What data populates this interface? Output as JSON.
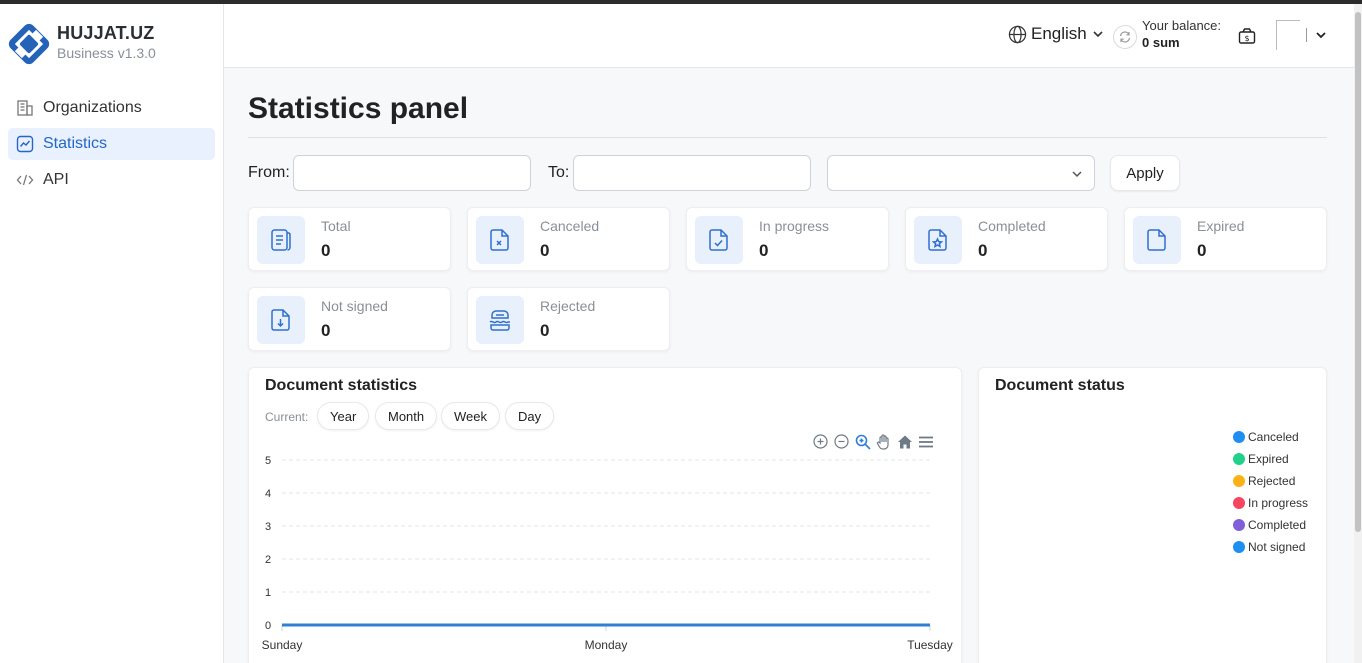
{
  "app": {
    "name": "HUJJAT.UZ",
    "version": "Business v1.3.0"
  },
  "sidebar": {
    "items": [
      {
        "label": "Organizations",
        "icon": "building-icon",
        "active": false
      },
      {
        "label": "Statistics",
        "icon": "chart-icon",
        "active": true
      },
      {
        "label": "API",
        "icon": "code-icon",
        "active": false
      }
    ]
  },
  "header": {
    "language": "English",
    "balance_label": "Your balance:",
    "balance_value": "0 sum"
  },
  "page": {
    "title": "Statistics panel"
  },
  "filters": {
    "from_label": "From:",
    "to_label": "To:",
    "from_value": "",
    "to_value": "",
    "select_value": "",
    "apply_label": "Apply"
  },
  "cards": [
    {
      "label": "Total",
      "value": "0",
      "icon": "document-list-icon"
    },
    {
      "label": "Canceled",
      "value": "0",
      "icon": "document-cancel-icon"
    },
    {
      "label": "In progress",
      "value": "0",
      "icon": "document-check-icon"
    },
    {
      "label": "Completed",
      "value": "0",
      "icon": "document-star-icon"
    },
    {
      "label": "Expired",
      "value": "0",
      "icon": "document-icon"
    },
    {
      "label": "Not signed",
      "value": "0",
      "icon": "document-download-icon"
    },
    {
      "label": "Rejected",
      "value": "0",
      "icon": "document-reject-icon"
    }
  ],
  "doc_stats": {
    "title": "Document statistics",
    "current_label": "Current:",
    "periods": [
      "Year",
      "Month",
      "Week",
      "Day"
    ]
  },
  "doc_status": {
    "title": "Document status",
    "legend": [
      {
        "label": "Canceled",
        "color": "#1e8ef0"
      },
      {
        "label": "Expired",
        "color": "#1fd18b"
      },
      {
        "label": "Rejected",
        "color": "#fbb117"
      },
      {
        "label": "In progress",
        "color": "#f6455f"
      },
      {
        "label": "Completed",
        "color": "#8060d8"
      },
      {
        "label": "Not signed",
        "color": "#1e8ef0"
      }
    ]
  },
  "colors": {
    "accent": "#2566c9",
    "line": "#2f7fd8",
    "icon_bg": "#e8f0fb"
  },
  "chart_data": {
    "type": "line",
    "categories": [
      "Sunday",
      "Monday",
      "Tuesday"
    ],
    "series": [
      {
        "values": [
          0,
          0,
          0
        ]
      }
    ],
    "yticks": [
      "0",
      "1",
      "2",
      "3",
      "4",
      "5"
    ],
    "ylim": [
      0,
      5
    ],
    "grid": true,
    "title": "",
    "xlabel": "",
    "ylabel": ""
  }
}
